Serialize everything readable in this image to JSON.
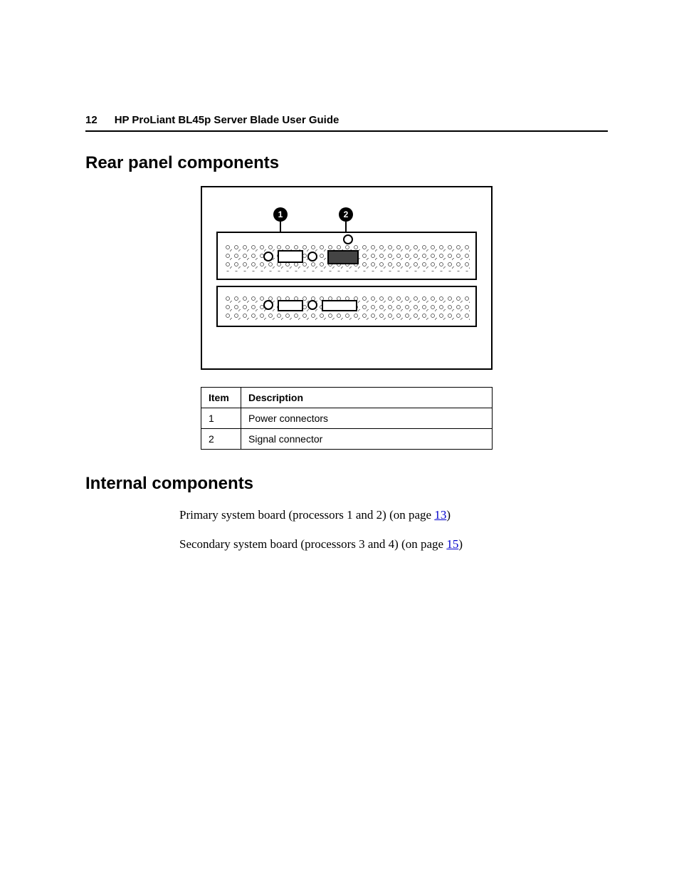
{
  "header": {
    "page_number": "12",
    "doc_title": "HP ProLiant BL45p Server Blade User Guide"
  },
  "sections": {
    "rear_panel": {
      "heading": "Rear panel components",
      "callouts": {
        "one": "1",
        "two": "2"
      },
      "table": {
        "headers": {
          "item": "Item",
          "description": "Description"
        },
        "rows": [
          {
            "item": "1",
            "description": "Power connectors"
          },
          {
            "item": "2",
            "description": "Signal connector"
          }
        ]
      }
    },
    "internal": {
      "heading": "Internal components",
      "lines": [
        {
          "prefix": "Primary system board (processors 1 and 2) (on page ",
          "link": "13",
          "suffix": ")"
        },
        {
          "prefix": "Secondary system board (processors 3 and 4) (on page ",
          "link": "15",
          "suffix": ")"
        }
      ]
    }
  }
}
